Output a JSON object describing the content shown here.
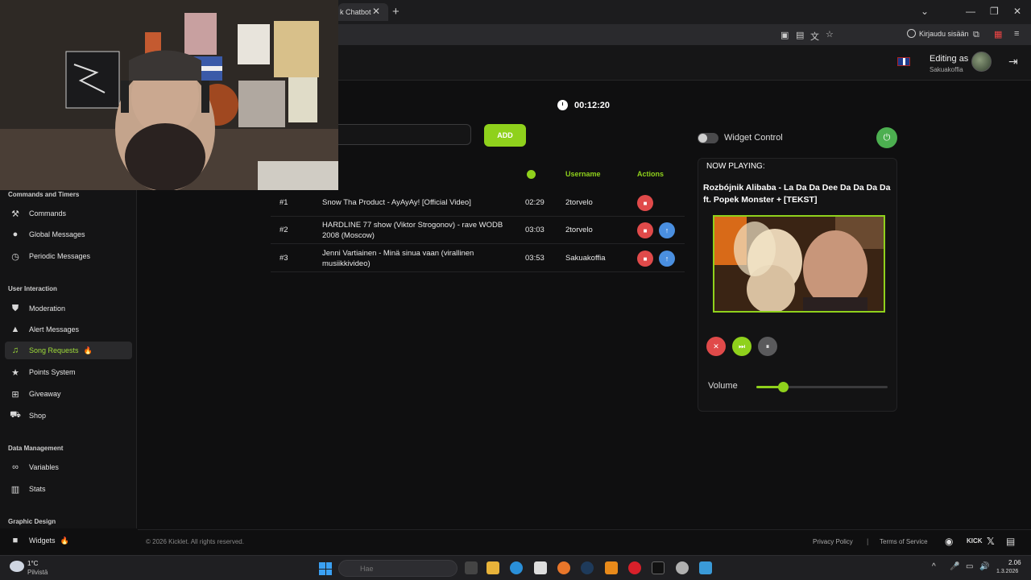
{
  "browser": {
    "tab_title": "k Chatbot",
    "signin_label": "Kirjaudu sisään"
  },
  "header": {
    "editing_label": "Editing as",
    "username": "Sakuakoffia"
  },
  "sidebar": {
    "sections": [
      {
        "label": "Commands and Timers"
      },
      {
        "label": "User Interaction"
      },
      {
        "label": "Data Management"
      },
      {
        "label": "Graphic Design"
      }
    ],
    "items": [
      {
        "label": "Commands",
        "icon": "hammer-icon"
      },
      {
        "label": "Global Messages",
        "icon": "chat-bubble-icon"
      },
      {
        "label": "Periodic Messages",
        "icon": "clock-icon"
      },
      {
        "label": "Moderation",
        "icon": "shield-icon"
      },
      {
        "label": "Alert Messages",
        "icon": "warning-icon"
      },
      {
        "label": "Song Requests",
        "icon": "music-note-icon",
        "active": true
      },
      {
        "label": "Points System",
        "icon": "star-icon"
      },
      {
        "label": "Giveaway",
        "icon": "gift-icon"
      },
      {
        "label": "Shop",
        "icon": "cart-icon"
      },
      {
        "label": "Variables",
        "icon": "link-icon"
      },
      {
        "label": "Stats",
        "icon": "bar-chart-icon"
      },
      {
        "label": "Widgets",
        "icon": "video-icon"
      }
    ]
  },
  "main": {
    "timer": "00:12:20",
    "add_label": "ADD",
    "columns": {
      "username": "Username",
      "actions": "Actions"
    },
    "queue": [
      {
        "num": "#1",
        "title": "Snow Tha Product - AyAyAy! [Official Video]",
        "duration": "02:29",
        "user": "2torvelo"
      },
      {
        "num": "#2",
        "title": "HARDLINE 77 show (Viktor Strogonov) - rave WODB 2008 (Moscow)",
        "duration": "03:03",
        "user": "2torvelo"
      },
      {
        "num": "#3",
        "title": "Jenni Vartiainen - Minä sinua vaan (virallinen musiikkivideo)",
        "duration": "03:53",
        "user": "Sakuakoffia"
      }
    ]
  },
  "widget": {
    "control_label": "Widget Control",
    "now_playing_label": "NOW PLAYING:",
    "now_playing_title": "Rozbójnik Alibaba - La Da Da Dee Da Da Da Da ft. Popek Monster + [TEKST]",
    "volume_label": "Volume",
    "volume_level": 0.2
  },
  "footer": {
    "copyright": "© 2026 Kicklet. All rights reserved.",
    "privacy": "Privacy Policy",
    "separator": "|",
    "terms": "Terms of Service",
    "kick": "KICK"
  },
  "taskbar": {
    "temp": "1°C",
    "weather": "Pilvistä",
    "search": "Hae",
    "time": "2.06",
    "date": "1.3.2026"
  },
  "colors": {
    "accent": "#8fd11c",
    "danger": "#e04a4a",
    "info": "#4a8fe0"
  }
}
